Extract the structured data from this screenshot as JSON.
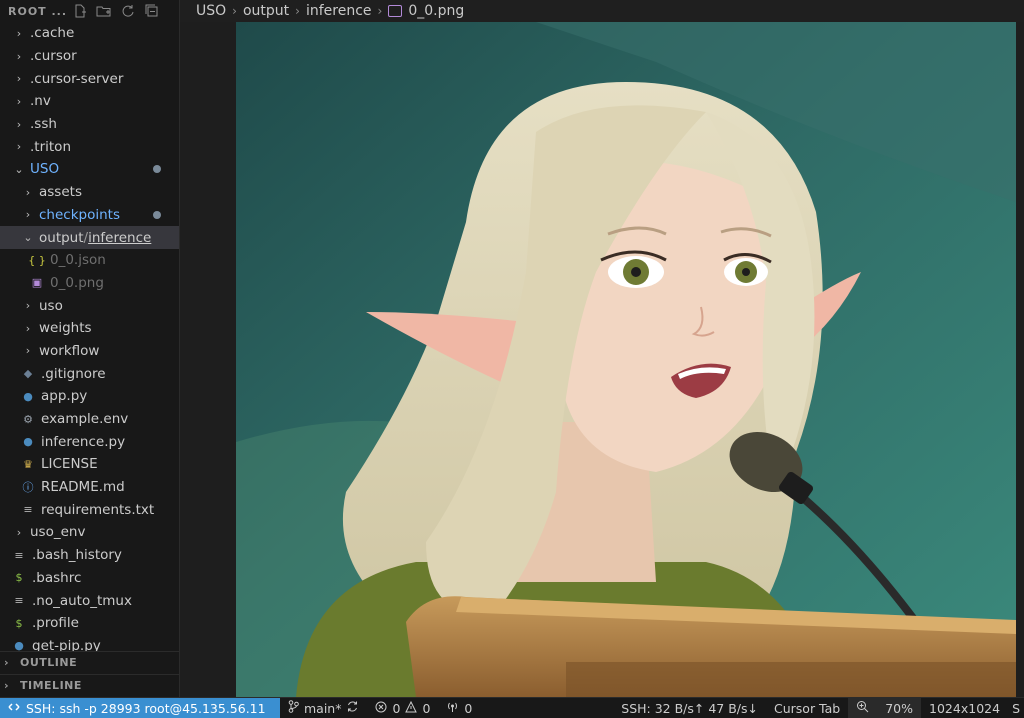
{
  "sidebar": {
    "title": "ROOT ...",
    "actions": [
      "new-file-icon",
      "new-folder-icon",
      "refresh-icon",
      "collapse-icon"
    ],
    "items": [
      {
        "label": ".cache",
        "type": "folder",
        "depth": 0,
        "open": false
      },
      {
        "label": ".cursor",
        "type": "folder",
        "depth": 0,
        "open": false
      },
      {
        "label": ".cursor-server",
        "type": "folder",
        "depth": 0,
        "open": false
      },
      {
        "label": ".nv",
        "type": "folder",
        "depth": 0,
        "open": false
      },
      {
        "label": ".ssh",
        "type": "folder",
        "depth": 0,
        "open": false
      },
      {
        "label": ".triton",
        "type": "folder",
        "depth": 0,
        "open": false
      },
      {
        "label": "USO",
        "type": "folder",
        "depth": 0,
        "open": true
      },
      {
        "label": "assets",
        "type": "folder",
        "depth": 1,
        "open": false
      },
      {
        "label": "checkpoints",
        "type": "folder",
        "depth": 1,
        "open": false
      },
      {
        "label_a": "output",
        "label_b": "inference",
        "type": "folder",
        "depth": 1,
        "open": true
      },
      {
        "label": "0_0.json",
        "type": "json",
        "depth": 2
      },
      {
        "label": "0_0.png",
        "type": "image",
        "depth": 2
      },
      {
        "label": "uso",
        "type": "folder",
        "depth": 1,
        "open": false
      },
      {
        "label": "weights",
        "type": "folder",
        "depth": 1,
        "open": false
      },
      {
        "label": "workflow",
        "type": "folder",
        "depth": 1,
        "open": false
      },
      {
        "label": ".gitignore",
        "type": "git",
        "depth": 1
      },
      {
        "label": "app.py",
        "type": "python",
        "depth": 1
      },
      {
        "label": "example.env",
        "type": "gear",
        "depth": 1
      },
      {
        "label": "inference.py",
        "type": "python",
        "depth": 1
      },
      {
        "label": "LICENSE",
        "type": "license",
        "depth": 1
      },
      {
        "label": "README.md",
        "type": "info",
        "depth": 1
      },
      {
        "label": "requirements.txt",
        "type": "text",
        "depth": 1
      },
      {
        "label": "uso_env",
        "type": "folder",
        "depth": 0,
        "open": false
      },
      {
        "label": ".bash_history",
        "type": "text",
        "depth": 0
      },
      {
        "label": ".bashrc",
        "type": "shell",
        "depth": 0
      },
      {
        "label": ".no_auto_tmux",
        "type": "text",
        "depth": 0
      },
      {
        "label": ".profile",
        "type": "shell",
        "depth": 0
      },
      {
        "label": "get-pip.py",
        "type": "python",
        "depth": 0
      }
    ],
    "sections": {
      "outline": "OUTLINE",
      "timeline": "TIMELINE"
    }
  },
  "breadcrumb": {
    "parts": [
      "USO",
      "output",
      "inference"
    ],
    "file": "0_0.png"
  },
  "status": {
    "remote": "SSH: ssh -p 28993 root@45.135.56.11",
    "branch": "main*",
    "errors": "0",
    "warnings": "0",
    "ports": "0",
    "transfer": "SSH: 32 B/s↑ 47 B/s↓",
    "cursor_tab": "Cursor Tab",
    "zoom": "70%",
    "dimensions": "1024x1024",
    "extra": "S"
  },
  "colors": {
    "accent": "#3a8fd1",
    "folder_blue": "#6fb3ff",
    "python": "#4b8bbe",
    "shell": "#8dc149"
  }
}
